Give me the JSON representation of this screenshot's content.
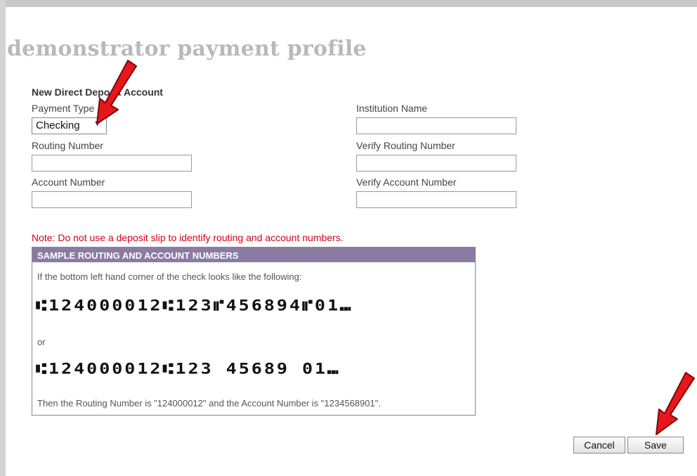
{
  "page": {
    "title": "demonstrator payment profile"
  },
  "form": {
    "section_title": "New Direct Deposit Account",
    "payment_type": {
      "label": "Payment Type",
      "selected": "Checking",
      "caret": "▼"
    },
    "institution_name": {
      "label": "Institution Name",
      "value": ""
    },
    "routing_number": {
      "label": "Routing Number",
      "value": ""
    },
    "verify_routing_number": {
      "label": "Verify Routing Number",
      "value": ""
    },
    "account_number": {
      "label": "Account Number",
      "value": ""
    },
    "verify_account_number": {
      "label": "Verify Account Number",
      "value": ""
    }
  },
  "note": "Note: Do not use a deposit slip to identify routing and account numbers.",
  "sample": {
    "heading": "SAMPLE ROUTING AND ACCOUNT NUMBERS",
    "intro": "If the bottom left hand corner of the check looks like the following:",
    "micr_line_1": "⑆124000012⑆123⑈456894⑈01⑉",
    "or": "or",
    "micr_line_2": "⑆124000012⑆123 45689 01⑉",
    "conclusion": "Then the Routing Number is \"124000012\" and the Account Number is \"1234568901\"."
  },
  "buttons": {
    "cancel": "Cancel",
    "save": "Save"
  },
  "colors": {
    "note_red": "#d0021b",
    "sample_header": "#8a7ba3",
    "arrow_red": "#e8161b"
  }
}
